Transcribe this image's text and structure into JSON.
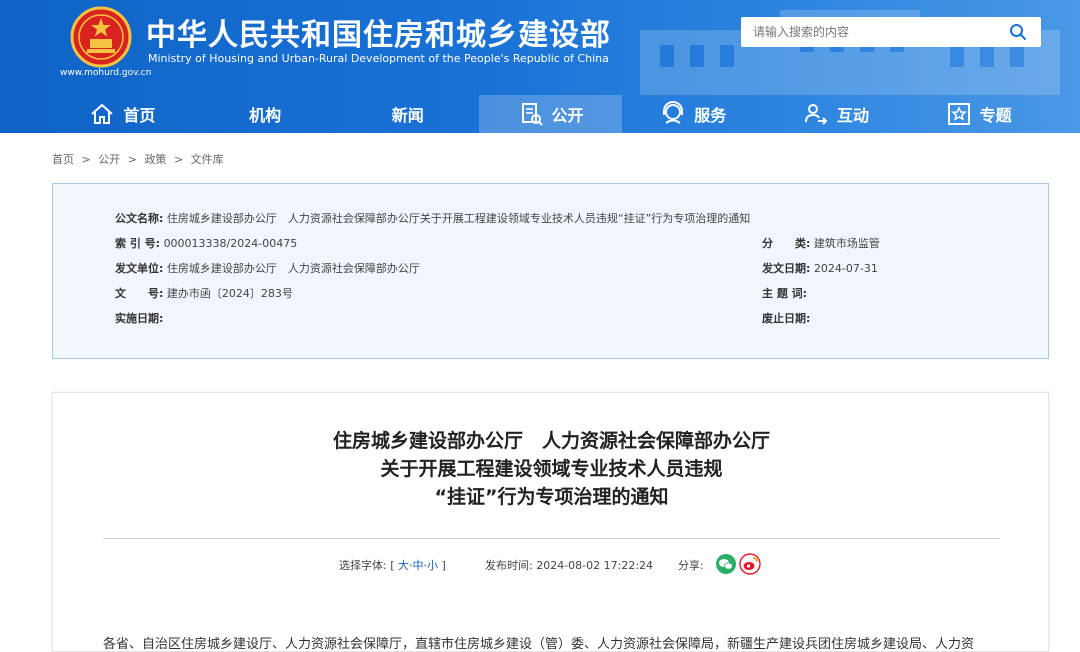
{
  "header": {
    "title": "中华人民共和国住房和城乡建设部",
    "subtitle": "Ministry of Housing and Urban-Rural Development of the People's Republic of China",
    "domain": "www.mohurd.gov.cn",
    "emblem_icon": "national-emblem-icon",
    "search_placeholder": "请输入搜索的内容"
  },
  "nav": {
    "items": [
      {
        "label": "首页",
        "icon": "home-icon"
      },
      {
        "label": "机构",
        "icon": ""
      },
      {
        "label": "新闻",
        "icon": ""
      },
      {
        "label": "公开",
        "icon": "document-icon",
        "active": true
      },
      {
        "label": "服务",
        "icon": "service-icon"
      },
      {
        "label": "互动",
        "icon": "interaction-icon"
      },
      {
        "label": "专题",
        "icon": "star-icon"
      }
    ]
  },
  "breadcrumb": [
    "首页",
    ">",
    "公开",
    ">",
    "政策",
    ">",
    "文件库"
  ],
  "meta": {
    "doc_name_label": "公文名称:",
    "doc_name": "住房城乡建设部办公厅　人力资源社会保障部办公厅关于开展工程建设领域专业技术人员违规“挂证”行为专项治理的通知",
    "index_label": "索 引 号:",
    "index": "000013338/2024-00475",
    "category_label": "分　　类:",
    "category": "建筑市场监管",
    "issuer_label": "发文单位:",
    "issuer": "住房城乡建设部办公厅　人力资源社会保障部办公厅",
    "issue_date_label": "发文日期:",
    "issue_date": "2024-07-31",
    "doc_no_label": "文　　号:",
    "doc_no": "建办市函〔2024〕283号",
    "subject_label": "主 题 词:",
    "subject": "",
    "effective_label": "实施日期:",
    "effective": "",
    "expiry_label": "废止日期:",
    "expiry": ""
  },
  "article": {
    "title_lines": [
      "住房城乡建设部办公厅　人力资源社会保障部办公厅",
      "关于开展工程建设领域专业技术人员违规",
      "“挂证”行为专项治理的通知"
    ],
    "font_size_label": "选择字体:",
    "font_size_open": "[",
    "font_large": "大",
    "font_mid": "中",
    "font_small": "小",
    "font_size_close": "]",
    "publish_time_label": "发布时间:",
    "publish_time": "2024-08-02 17:22:24",
    "share_label": "分享:",
    "share_icons": [
      "wechat-icon",
      "weibo-icon"
    ],
    "body_first_line": "各省、自治区住房城乡建设厅、人力资源社会保障厅，直辖市住房城乡建设（管）委、人力资源社会保障局，新疆生产建设兵团住房城乡建设局、人力资"
  },
  "colors": {
    "header_blue": "#1a72d6",
    "nav_active": "#4a90da",
    "meta_bg": "#f0f6fc",
    "link_blue": "#1a5fb4",
    "wechat_green": "#2aae67",
    "weibo_red": "#e6162d"
  }
}
